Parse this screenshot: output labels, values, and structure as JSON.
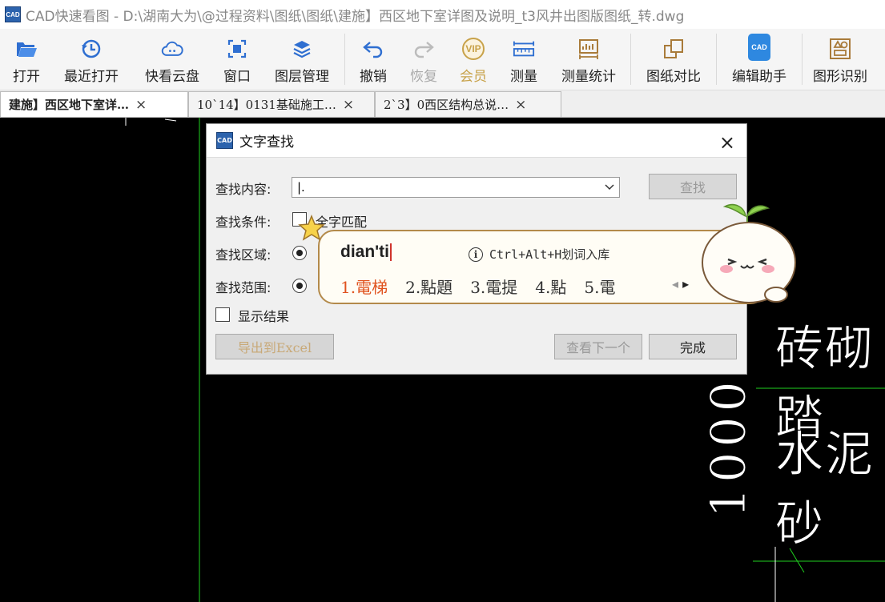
{
  "window": {
    "app_logo_text": "CAD",
    "title": "CAD快速看图 - D:\\湖南大为\\@过程资料\\图纸\\图纸\\建施】西区地下室详图及说明_t3风井出图版图纸_转.dwg"
  },
  "toolbar": {
    "items": [
      {
        "label": "打开",
        "icon": "folder-open-icon"
      },
      {
        "label": "最近打开",
        "icon": "recent-icon"
      },
      {
        "label": "快看云盘",
        "icon": "cloud-icon"
      },
      {
        "label": "窗口",
        "icon": "window-icon"
      },
      {
        "label": "图层管理",
        "icon": "layers-icon"
      },
      {
        "label": "撤销",
        "icon": "undo-icon"
      },
      {
        "label": "恢复",
        "icon": "redo-icon"
      },
      {
        "label": "会员",
        "icon": "vip-icon",
        "icon_text": "VIP"
      },
      {
        "label": "测量",
        "icon": "ruler-icon"
      },
      {
        "label": "测量统计",
        "icon": "measure-stats-icon"
      },
      {
        "label": "图纸对比",
        "icon": "compare-icon"
      },
      {
        "label": "编辑助手",
        "icon": "edit-assistant-icon",
        "icon_text": "CAD"
      },
      {
        "label": "图形识别",
        "icon": "shape-recognition-icon"
      }
    ],
    "accent": "#3a7ad9",
    "vip_color": "#c8a24a"
  },
  "tabs": [
    {
      "label": "建施】西区地下室详…",
      "close": "×",
      "active": true
    },
    {
      "label": "10`14】0131基础施工…",
      "close": "×",
      "active": false
    },
    {
      "label": "2`3】0西区结构总说…",
      "close": "×",
      "active": false
    }
  ],
  "canvas": {
    "text_1": "砖砌踏",
    "text_2": "水泥砂",
    "dimension": "1000",
    "line_color": "#1fd11f"
  },
  "dialog": {
    "logo_text": "CAD",
    "title": "文字查找",
    "close": "×",
    "find_label": "查找内容:",
    "find_value": "|.",
    "find_button": "查找",
    "condition_label": "查找条件:",
    "whole_word": "全字匹配",
    "area_label": "查找区域:",
    "scope_label": "查找范围:",
    "show_results": "显示结果",
    "export_button": "导出到Excel",
    "next_button": "查看下一个",
    "done_button": "完成"
  },
  "ime": {
    "pinyin": "dian'ti",
    "hint": "Ctrl+Alt+H划词入库",
    "candidates": [
      "1.電梯",
      "2.點題",
      "3.電提",
      "4.點",
      "5.電"
    ],
    "nav_prev": "◂",
    "nav_next": "▸",
    "accent": "#e0531f"
  }
}
